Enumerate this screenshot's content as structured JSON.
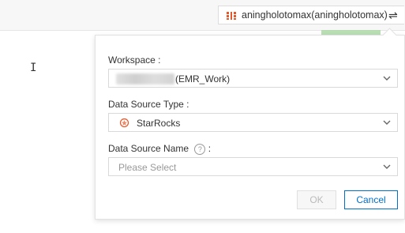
{
  "account": {
    "name": "aningholotomax(aningholotomax)",
    "switch_icon": "⇌"
  },
  "form": {
    "workspace": {
      "label": "Workspace :",
      "value_suffix": "(EMR_Work)"
    },
    "data_source_type": {
      "label": "Data Source Type :",
      "value": "StarRocks"
    },
    "data_source_name": {
      "label": "Data Source Name",
      "label_suffix": ":",
      "placeholder": "Please Select"
    }
  },
  "buttons": {
    "ok": "OK",
    "cancel": "Cancel"
  },
  "colors": {
    "primary": "#0070cc",
    "starrocks_icon": "#e5582a",
    "account_icon": "#e5582a"
  },
  "icons": {
    "cursor": "I",
    "help": "?"
  }
}
